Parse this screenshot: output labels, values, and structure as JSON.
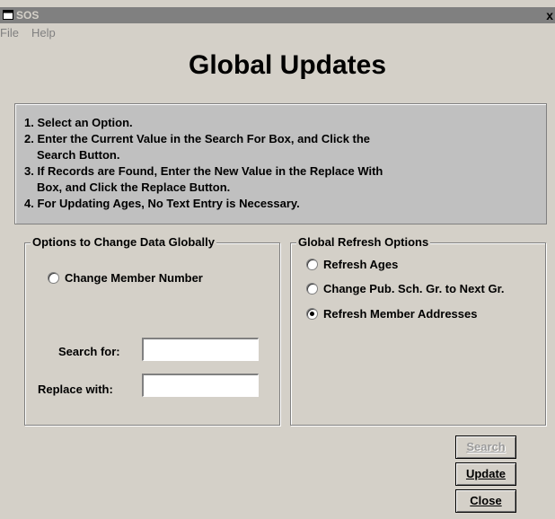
{
  "window": {
    "title": "SOS",
    "close_label": "x"
  },
  "menu": {
    "file": "File",
    "help": "Help"
  },
  "heading": "Global Updates",
  "instructions": [
    "1. Select an Option.",
    "2. Enter the Current Value in the Search For Box, and Click the",
    "Search Button.",
    "3. If Records are Found, Enter the New Value in the Replace With",
    "Box, and Click the Replace Button.",
    "4. For Updating Ages, No Text Entry is Necessary."
  ],
  "options_group": {
    "legend": "Options to Change Data Globally",
    "radio_label": "Change Member Number",
    "search_label": "Search for:",
    "search_value": "",
    "replace_label": "Replace with:",
    "replace_value": ""
  },
  "refresh_group": {
    "legend": "Global Refresh Options",
    "options": [
      {
        "label": "Refresh Ages",
        "checked": false
      },
      {
        "label": "Change Pub. Sch. Gr. to Next Gr.",
        "checked": false
      },
      {
        "label": "Refresh Member Addresses",
        "checked": true
      }
    ]
  },
  "buttons": {
    "search": "Search",
    "search_enabled": false,
    "update": "Update",
    "close": "Close"
  }
}
